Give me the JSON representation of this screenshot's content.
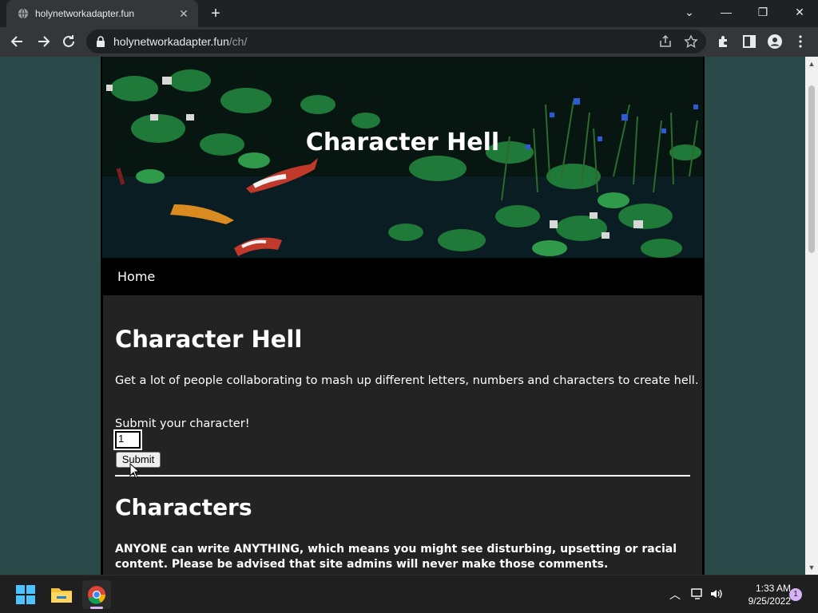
{
  "browser": {
    "tab_title": "holynetworkadapter.fun",
    "url_domain": "holynetworkadapter.fun",
    "url_path": "/ch/"
  },
  "site": {
    "banner_title": "Character Hell",
    "nav_home": "Home"
  },
  "content": {
    "heading": "Character Hell",
    "intro": "Get a lot of people collaborating to mash up different letters, numbers and characters to create hell.",
    "submit_label": "Submit your character!",
    "input_value": "1",
    "submit_button": "Submit",
    "characters_heading": "Characters",
    "warning": "ANYONE can write ANYTHING, which means you might see disturbing, upsetting or racial content. Please be advised that site admins will never make those comments."
  },
  "taskbar": {
    "time": "1:33 AM",
    "date": "9/25/2022",
    "notification_count": "1"
  },
  "colors": {
    "page_background": "#2a4a4a",
    "content_background": "#232323"
  }
}
